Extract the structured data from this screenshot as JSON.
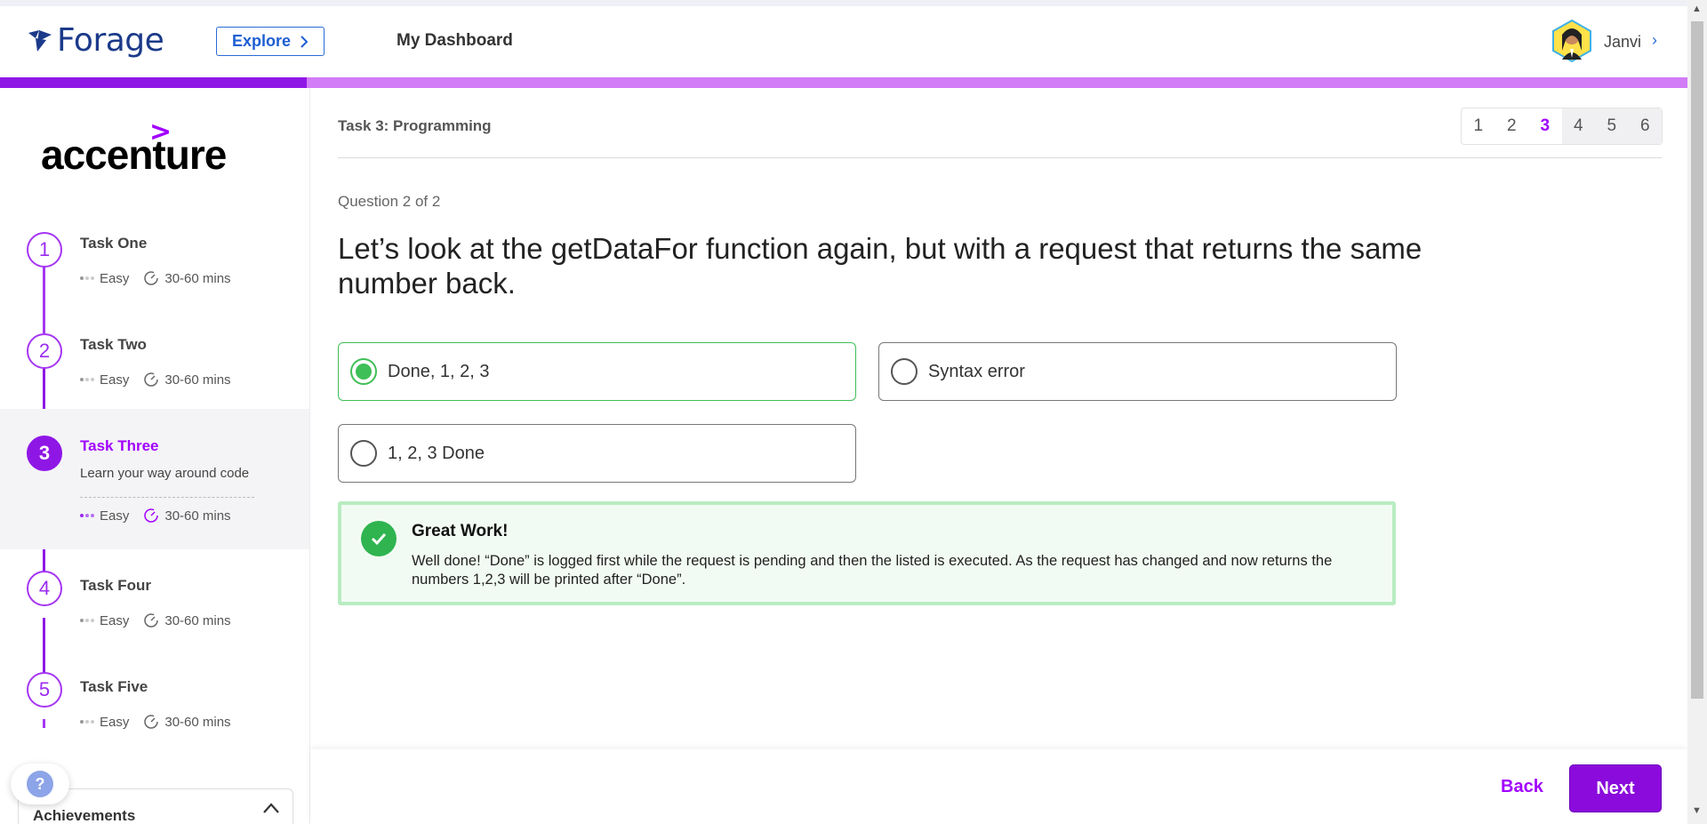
{
  "header": {
    "logo_text": "Forage",
    "explore_label": "Explore",
    "dashboard_label": "My Dashboard",
    "user_name": "Janvi",
    "user_chevron": "›"
  },
  "progress": {
    "fraction": 0.182,
    "fill_color": "#8f17e6",
    "track_color": "#d27cf7"
  },
  "sidebar": {
    "brand_chevron": ">",
    "brand": "accenture",
    "tasks": [
      {
        "num": "1",
        "title": "Task One",
        "difficulty": "Easy",
        "duration": "30-60 mins"
      },
      {
        "num": "2",
        "title": "Task Two",
        "difficulty": "Easy",
        "duration": "30-60 mins"
      },
      {
        "num": "3",
        "title": "Task Three",
        "subtitle": "Learn your way around code",
        "difficulty": "Easy",
        "duration": "30-60 mins"
      },
      {
        "num": "4",
        "title": "Task Four",
        "difficulty": "Easy",
        "duration": "30-60 mins"
      },
      {
        "num": "5",
        "title": "Task Five",
        "difficulty": "Easy",
        "duration": "30-60 mins"
      }
    ],
    "achievements_label": "Achievements",
    "help_label": "?"
  },
  "main": {
    "task_label": "Task 3: Programming",
    "pager": [
      "1",
      "2",
      "3",
      "4",
      "5",
      "6"
    ],
    "pager_current": "3",
    "question_count": "Question 2 of 2",
    "question": "Let’s look at the getDataFor function again, but with a request that returns the same number back.",
    "options": [
      {
        "label": "Done, 1, 2, 3",
        "selected": true
      },
      {
        "label": "Syntax error",
        "selected": false
      },
      {
        "label": "1, 2, 3 Done",
        "selected": false
      }
    ],
    "feedback": {
      "title": "Great Work!",
      "body": "Well done! “Done” is logged first while the request is pending and then the listed is executed. As the request has changed and now returns the numbers 1,2,3 will be printed after “Done”."
    }
  },
  "footer": {
    "back_label": "Back",
    "next_label": "Next"
  },
  "colors": {
    "accent": "#a100ff",
    "success": "#3fbf57",
    "link": "#1e5fd3"
  }
}
